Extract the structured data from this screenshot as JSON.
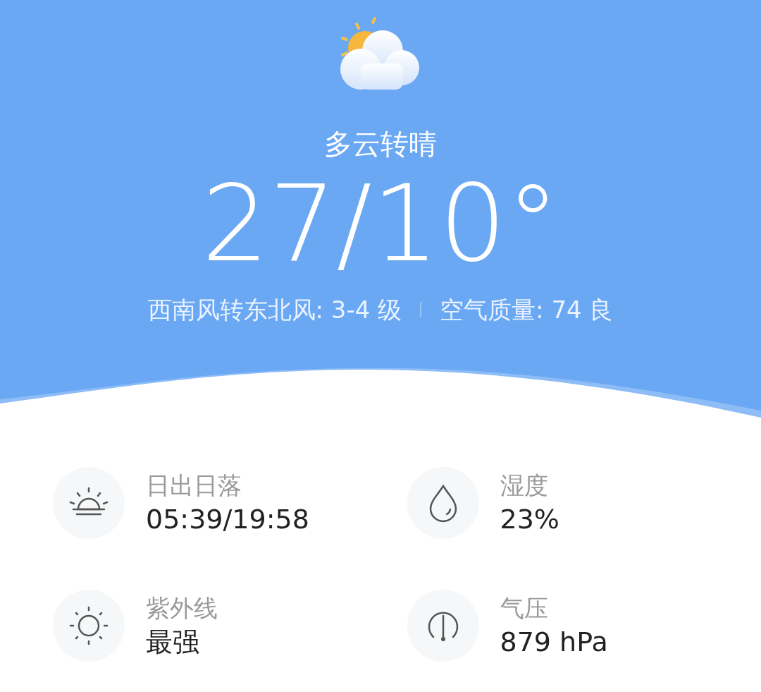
{
  "weather": {
    "condition": "多云转晴",
    "temperature": "27/10°",
    "wind": "西南风转东北风: 3-4 级",
    "air_quality": "空气质量: 74 良"
  },
  "details": [
    {
      "kind": "sunrise",
      "label": "日出日落",
      "value": "05:39/19:58"
    },
    {
      "kind": "humidity",
      "label": "湿度",
      "value": "23%"
    },
    {
      "kind": "uv",
      "label": "紫外线",
      "value": "最强"
    },
    {
      "kind": "pressure",
      "label": "气压",
      "value": "879 hPa"
    }
  ]
}
